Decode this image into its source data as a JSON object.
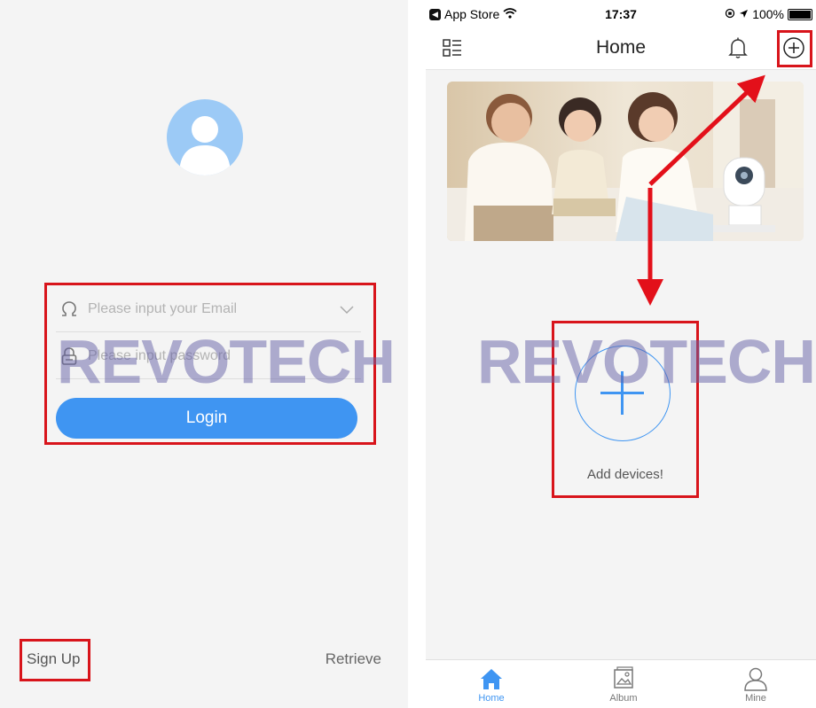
{
  "login_screen": {
    "email_placeholder": "Please input your Email",
    "password_placeholder": "Please input password",
    "login_label": "Login",
    "sign_up_label": "Sign Up",
    "retrieve_label": "Retrieve"
  },
  "status_bar": {
    "carrier": "App Store",
    "time": "17:37",
    "battery": "100%"
  },
  "home_screen": {
    "title": "Home",
    "add_devices_label": "Add devices!"
  },
  "tab_bar": {
    "tabs": [
      {
        "label": "Home",
        "icon": "house-icon",
        "active": true
      },
      {
        "label": "Album",
        "icon": "album-icon",
        "active": false
      },
      {
        "label": "Mine",
        "icon": "person-icon",
        "active": false
      }
    ]
  },
  "watermark": {
    "text": "REVOTECH"
  },
  "colors": {
    "accent": "#3f95f2",
    "highlight": "#d8141b",
    "avatar": "#9ccaf6",
    "background": "#f4f4f4"
  }
}
